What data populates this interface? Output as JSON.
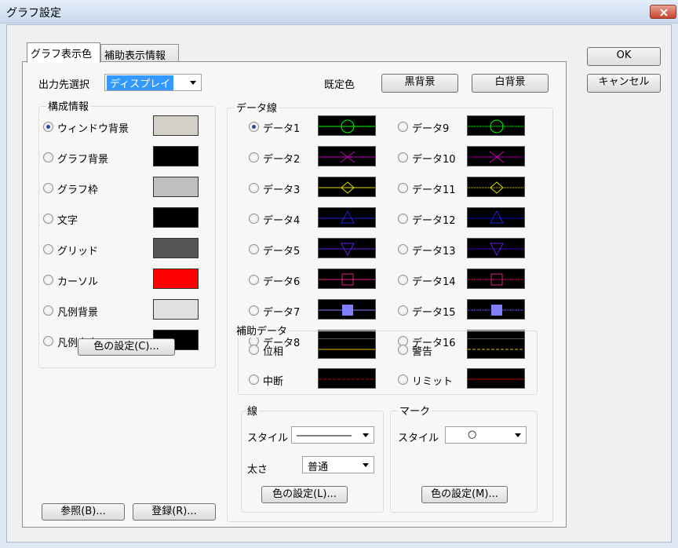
{
  "window": {
    "title": "グラフ設定"
  },
  "tabs": [
    {
      "label": "グラフ表示色",
      "active": true
    },
    {
      "label": "補助表示情報",
      "active": false
    }
  ],
  "buttons": {
    "ok": "OK",
    "cancel": "キャンセル",
    "black_bg": "黒背景",
    "white_bg": "白背景",
    "ref": "参照(B)...",
    "register": "登録(R)...",
    "color_config": "色の設定(C)...",
    "line_color": "色の設定(L)...",
    "mark_color": "色の設定(M)..."
  },
  "output": {
    "label": "出力先選択",
    "value": "ディスプレイ"
  },
  "preset_label": "既定色",
  "config": {
    "title": "構成情報",
    "items": [
      {
        "label": "ウィンドウ背景",
        "color": "#d4d0c8",
        "checked": true
      },
      {
        "label": "グラフ背景",
        "color": "#000000",
        "checked": false
      },
      {
        "label": "グラフ枠",
        "color": "#c0c0c0",
        "checked": false
      },
      {
        "label": "文字",
        "color": "#000000",
        "checked": false
      },
      {
        "label": "グリッド",
        "color": "#555555",
        "checked": false
      },
      {
        "label": "カーソル",
        "color": "#ff0000",
        "checked": false
      },
      {
        "label": "凡例背景",
        "color": "#e0e0e0",
        "checked": false
      },
      {
        "label": "凡例文字",
        "color": "#000000",
        "checked": false
      }
    ]
  },
  "data_lines": {
    "title": "データ線",
    "items": [
      {
        "label": "データ1",
        "color": "#00ff00",
        "marker": "circle",
        "checked": true
      },
      {
        "label": "データ2",
        "color": "#c000c0",
        "marker": "x",
        "checked": false
      },
      {
        "label": "データ3",
        "color": "#e0e000",
        "marker": "diamond",
        "checked": false
      },
      {
        "label": "データ4",
        "color": "#2020e0",
        "marker": "triangle",
        "checked": false
      },
      {
        "label": "データ5",
        "color": "#6020e0",
        "marker": "triangle-down",
        "checked": false
      },
      {
        "label": "データ6",
        "color": "#e0207a",
        "marker": "square",
        "checked": false
      },
      {
        "label": "データ7",
        "color": "#8080ff",
        "marker": "filled-square",
        "checked": false
      },
      {
        "label": "データ8",
        "color": "#e040a0",
        "marker": "none",
        "checked": false
      },
      {
        "label": "データ9",
        "color": "#00ff00",
        "marker": "circle",
        "checked": false
      },
      {
        "label": "データ10",
        "color": "#c000c0",
        "marker": "x",
        "checked": false
      },
      {
        "label": "データ11",
        "color": "#e0e000",
        "marker": "diamond",
        "checked": false
      },
      {
        "label": "データ12",
        "color": "#2020e0",
        "marker": "triangle",
        "checked": false
      },
      {
        "label": "データ13",
        "color": "#6020e0",
        "marker": "triangle-down",
        "checked": false
      },
      {
        "label": "データ14",
        "color": "#e0207a",
        "marker": "square",
        "checked": false
      },
      {
        "label": "データ15",
        "color": "#8080ff",
        "marker": "filled-square",
        "checked": false
      },
      {
        "label": "データ16",
        "color": "#e040a0",
        "marker": "none",
        "checked": false
      }
    ]
  },
  "aux": {
    "title": "補助データ",
    "items": [
      {
        "label": "位相",
        "color": "#e0c000",
        "dash": "solid"
      },
      {
        "label": "中断",
        "color": "#c00000",
        "dash": "dashed"
      },
      {
        "label": "警告",
        "color": "#e0c000",
        "dash": "dashed"
      },
      {
        "label": "リミット",
        "color": "#c00000",
        "dash": "solid"
      }
    ]
  },
  "line": {
    "title": "線",
    "style_label": "スタイル",
    "width_label": "太さ",
    "width_value": "普通"
  },
  "mark": {
    "title": "マーク",
    "style_label": "スタイル",
    "style_value": "○"
  }
}
